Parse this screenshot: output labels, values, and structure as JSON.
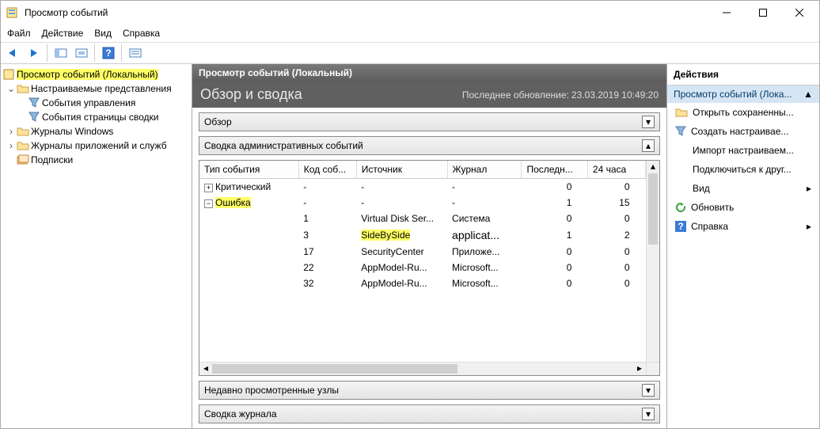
{
  "window": {
    "title": "Просмотр событий"
  },
  "menu": {
    "file": "Файл",
    "action": "Действие",
    "view": "Вид",
    "help": "Справка"
  },
  "tree": {
    "root": "Просмотр событий (Локальный)",
    "custom": "Настраиваемые представления",
    "mgmt": "События управления",
    "summary": "События страницы сводки",
    "winlogs": "Журналы Windows",
    "applogs": "Журналы приложений и служб",
    "subs": "Подписки"
  },
  "center": {
    "title": "Просмотр событий (Локальный)",
    "overview": "Обзор и сводка",
    "updated_label": "Последнее обновление:",
    "updated_value": "23.03.2019 10:49:20",
    "acc_overview": "Обзор",
    "acc_admin": "Сводка административных событий",
    "acc_recent": "Недавно просмотренные узлы",
    "acc_logsum": "Сводка журнала"
  },
  "columns": {
    "type": "Тип события",
    "code": "Код соб...",
    "source": "Источник",
    "log": "Журнал",
    "last": "Последн...",
    "h24": "24 часа"
  },
  "rows": [
    {
      "type": "Критический",
      "code": "-",
      "source": "-",
      "log": "-",
      "last": "0",
      "h24": "0",
      "top": true
    },
    {
      "type": "Ошибка",
      "code": "-",
      "source": "-",
      "log": "-",
      "last": "1",
      "h24": "15",
      "top": true,
      "hl": true
    },
    {
      "type": "",
      "code": "1",
      "source": "Virtual Disk Ser...",
      "log": "Система",
      "last": "0",
      "h24": "0"
    },
    {
      "type": "",
      "code": "3",
      "source": "SideBySide",
      "log": "applicat...",
      "last": "1",
      "h24": "2",
      "hl_src": true
    },
    {
      "type": "",
      "code": "17",
      "source": "SecurityCenter",
      "log": "Приложе...",
      "last": "0",
      "h24": "0"
    },
    {
      "type": "",
      "code": "22",
      "source": "AppModel-Ru...",
      "log": "Microsoft...",
      "last": "0",
      "h24": "0"
    },
    {
      "type": "",
      "code": "32",
      "source": "AppModel-Ru...",
      "log": "Microsoft...",
      "last": "0",
      "h24": "0"
    }
  ],
  "actions": {
    "title": "Действия",
    "header": "Просмотр событий (Лока...",
    "open": "Открыть сохраненны...",
    "create": "Создать настраивае...",
    "import": "Импорт настраиваем...",
    "connect": "Подключиться к друг...",
    "view": "Вид",
    "refresh": "Обновить",
    "help": "Справка"
  }
}
